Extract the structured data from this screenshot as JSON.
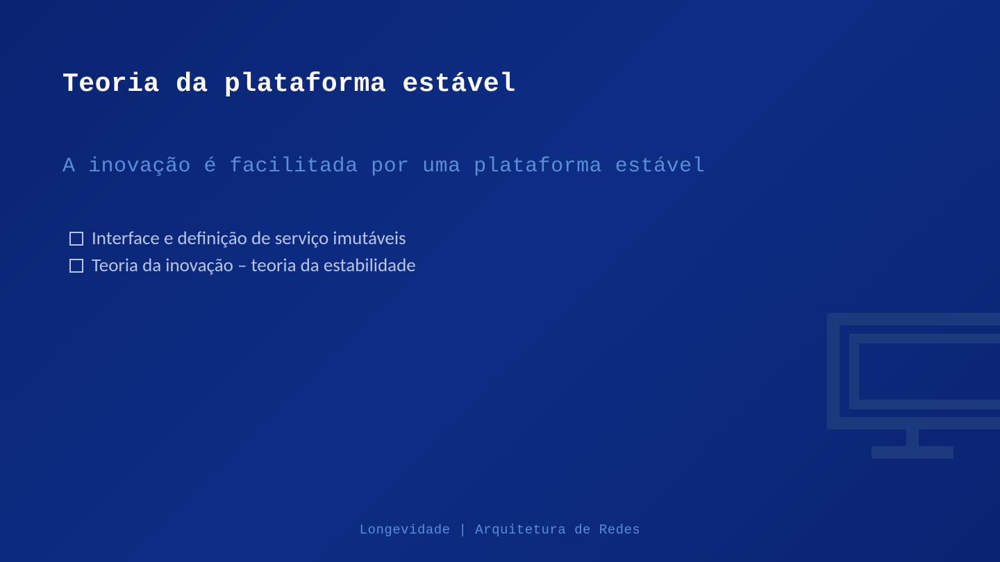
{
  "slide": {
    "title": "Teoria da plataforma estável",
    "subtitle": "A inovação é facilitada por uma plataforma estável",
    "bullets": [
      "Interface e definição de serviço imutáveis",
      "Teoria da inovação – teoria da estabilidade"
    ],
    "footer": "Longevidade | Arquitetura de Redes"
  }
}
